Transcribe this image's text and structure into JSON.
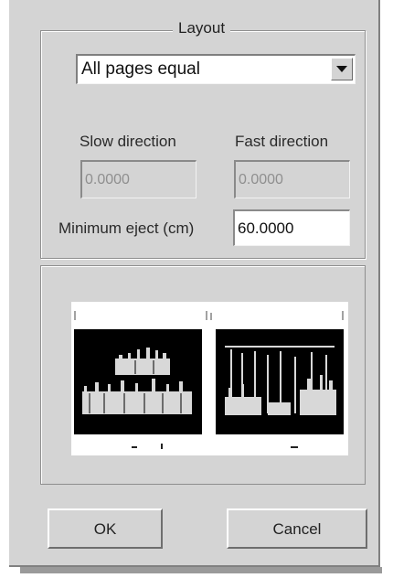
{
  "layout": {
    "title": "Layout",
    "mode_selected": "All pages equal"
  },
  "direction": {
    "slow_label": "Slow direction",
    "slow_value": "0.0000",
    "fast_label": "Fast direction",
    "fast_value": "0.0000"
  },
  "minimum_eject": {
    "label": "Minimum eject (cm)",
    "value": "60.0000"
  },
  "buttons": {
    "ok": "OK",
    "cancel": "Cancel"
  },
  "colors": {
    "dialog_bg": "#d4d4d4",
    "preview_page": "#000000"
  }
}
